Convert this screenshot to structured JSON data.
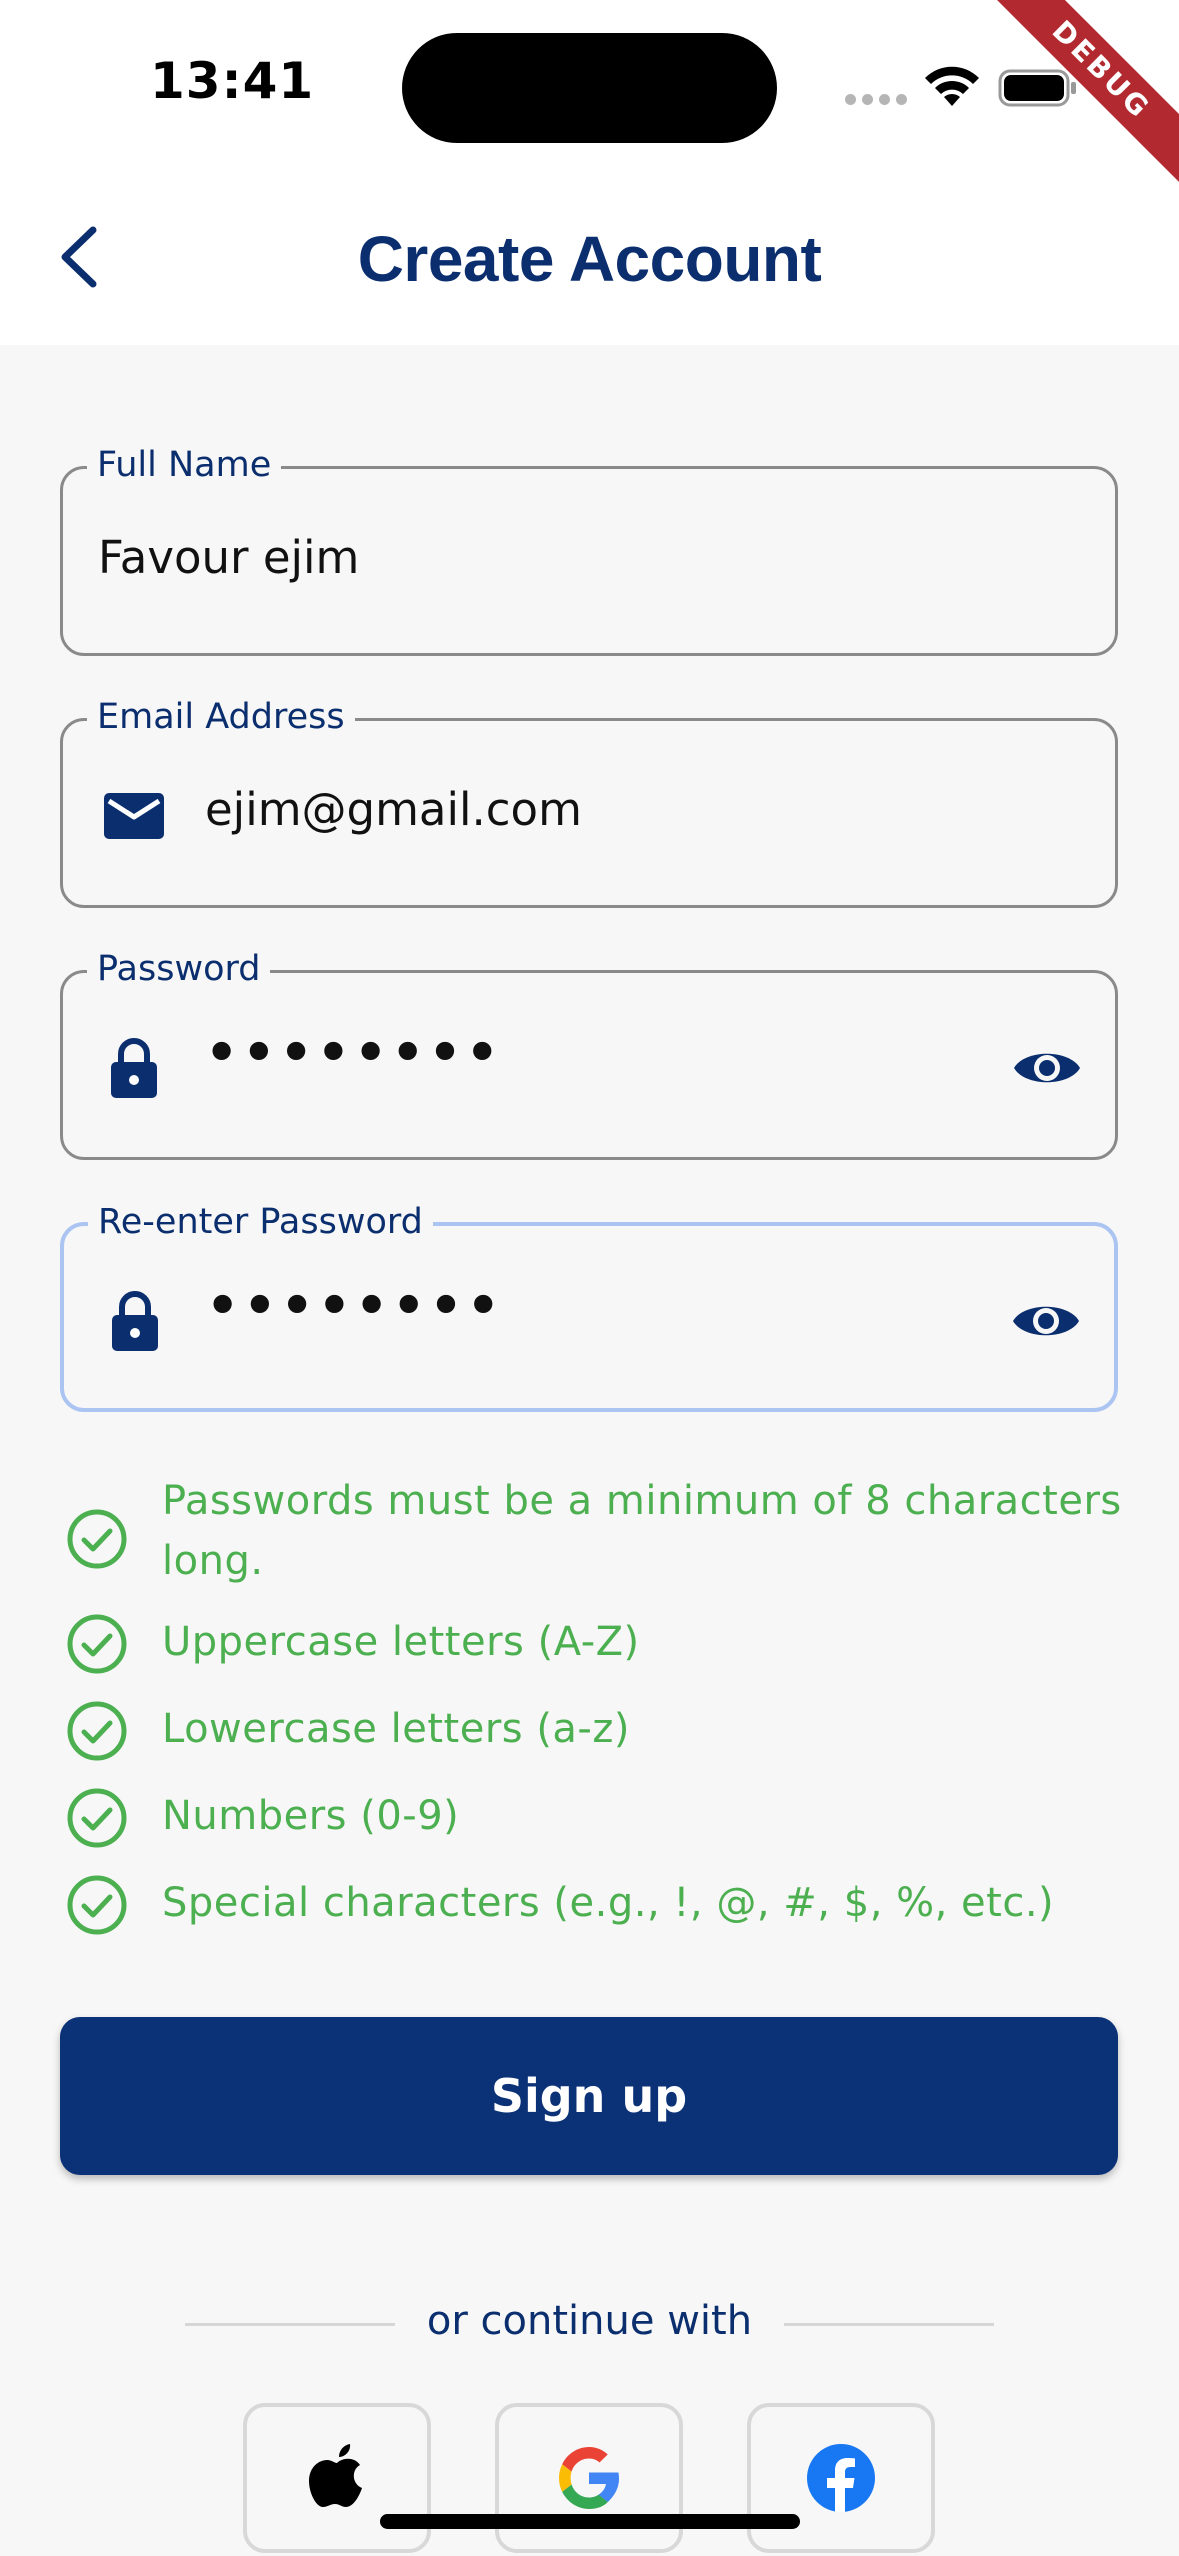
{
  "status_bar": {
    "time": "13:41",
    "debug_label": "DEBUG"
  },
  "header": {
    "title": "Create Account"
  },
  "form": {
    "full_name": {
      "label": "Full Name",
      "value": "Favour ejim"
    },
    "email": {
      "label": "Email Address",
      "value": "ejim@gmail.com",
      "icon": "mail-icon"
    },
    "password": {
      "label": "Password",
      "value": "••••••••",
      "icon": "lock-icon"
    },
    "confirm_password": {
      "label": "Re-enter Password",
      "value": "••••••••",
      "icon": "lock-icon"
    }
  },
  "password_rules": [
    {
      "text": "Passwords must be a minimum of 8 characters long.",
      "met": true
    },
    {
      "text": "Uppercase letters (A-Z)",
      "met": true
    },
    {
      "text": "Lowercase letters (a-z)",
      "met": true
    },
    {
      "text": "Numbers (0-9)",
      "met": true
    },
    {
      "text": "Special characters (e.g., !, @, #, $, %, etc.)",
      "met": true
    }
  ],
  "signup_button": {
    "label": "Sign up"
  },
  "social": {
    "divider_text": "or continue with",
    "providers": [
      "apple-icon",
      "google-icon",
      "facebook-icon"
    ]
  },
  "colors": {
    "primary": "#0b3177",
    "title": "#0b2e6e",
    "success": "#4caf50",
    "focus_border": "#abc4f2",
    "debug_ribbon": "#b22a2f"
  }
}
